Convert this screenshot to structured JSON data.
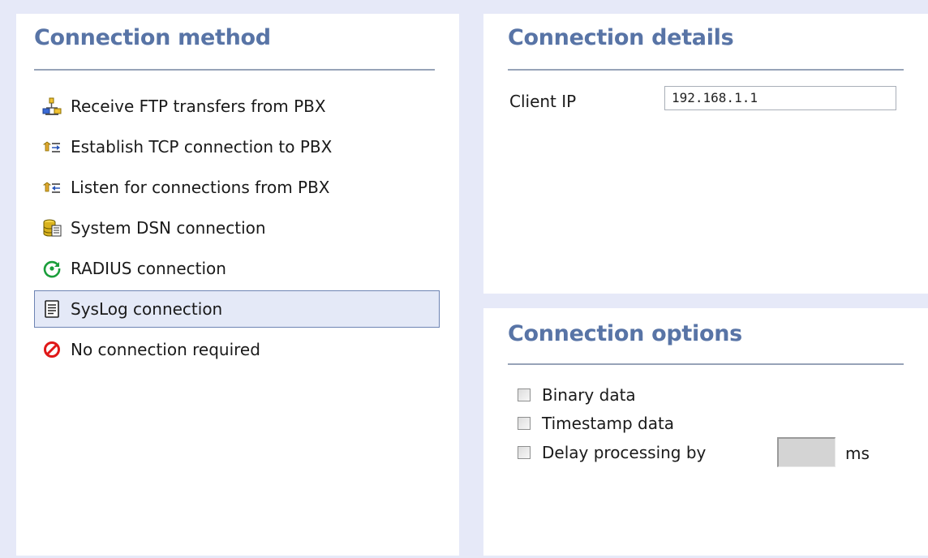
{
  "connection_method": {
    "title": "Connection method",
    "items": [
      {
        "label": "Receive FTP transfers from PBX",
        "icon": "ftp-network-icon",
        "selected": false
      },
      {
        "label": "Establish TCP connection to PBX",
        "icon": "tcp-outbound-icon",
        "selected": false
      },
      {
        "label": "Listen for connections from PBX",
        "icon": "tcp-inbound-icon",
        "selected": false
      },
      {
        "label": "System DSN connection",
        "icon": "database-icon",
        "selected": false
      },
      {
        "label": "RADIUS connection",
        "icon": "radius-icon",
        "selected": false
      },
      {
        "label": "SysLog connection",
        "icon": "syslog-document-icon",
        "selected": true
      },
      {
        "label": "No connection required",
        "icon": "no-entry-icon",
        "selected": false
      }
    ]
  },
  "connection_details": {
    "title": "Connection details",
    "client_ip_label": "Client IP",
    "client_ip_value": "192.168.1.1"
  },
  "connection_options": {
    "title": "Connection options",
    "binary_data_label": "Binary data",
    "binary_data_checked": false,
    "timestamp_data_label": "Timestamp data",
    "timestamp_data_checked": false,
    "delay_label": "Delay processing by",
    "delay_checked": false,
    "delay_value": "",
    "delay_unit": "ms"
  },
  "colors": {
    "page_background": "#e6e9f8",
    "title_blue": "#5874a6",
    "selection_border": "#6d84b3",
    "selection_fill": "#e4e9f7"
  }
}
